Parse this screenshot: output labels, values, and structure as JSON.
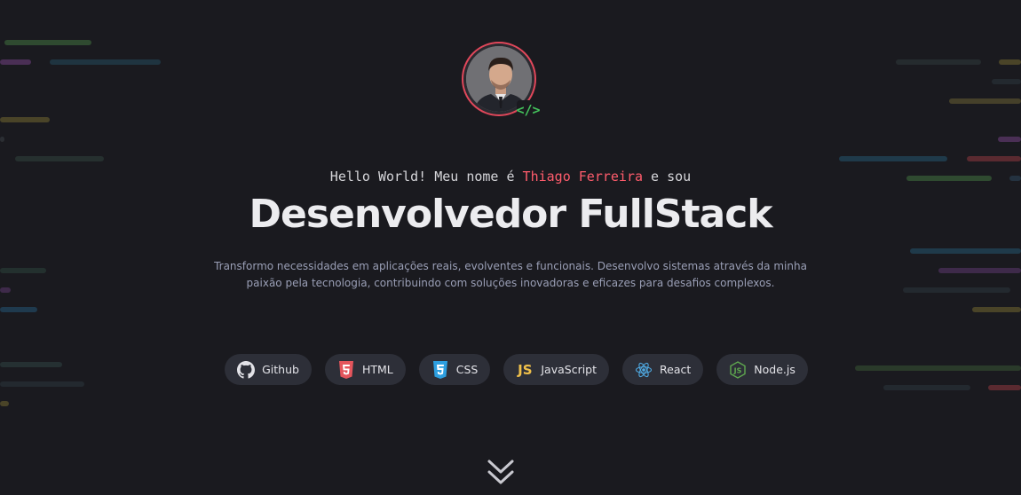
{
  "hero": {
    "hello_prefix": "Hello World! Meu nome é ",
    "name": "Thiago Ferreira",
    "hello_suffix": " e sou",
    "headline": "Desenvolvedor FullStack",
    "description_line1": "Transformo necessidades em aplicações reais, evolventes e funcionais. Desenvolvo sistemas através da minha",
    "description_line2": "paixão pela tecnologia, contribuindo com soluções inovadoras e eficazes para desafios complexos.",
    "badge_text": "</>"
  },
  "techs": [
    {
      "label": "Github",
      "icon": "github-icon"
    },
    {
      "label": "HTML",
      "icon": "html5-icon"
    },
    {
      "label": "CSS",
      "icon": "css3-icon"
    },
    {
      "label": "JavaScript",
      "icon": "javascript-icon",
      "icon_text": "JS"
    },
    {
      "label": "React",
      "icon": "react-icon"
    },
    {
      "label": "Node.js",
      "icon": "nodejs-icon",
      "icon_text": "JS"
    }
  ],
  "colors": {
    "background": "#1a1a1f",
    "accent": "#ff5c6c",
    "chip_bg": "#2d2f38",
    "code_green": "#44c35c"
  }
}
